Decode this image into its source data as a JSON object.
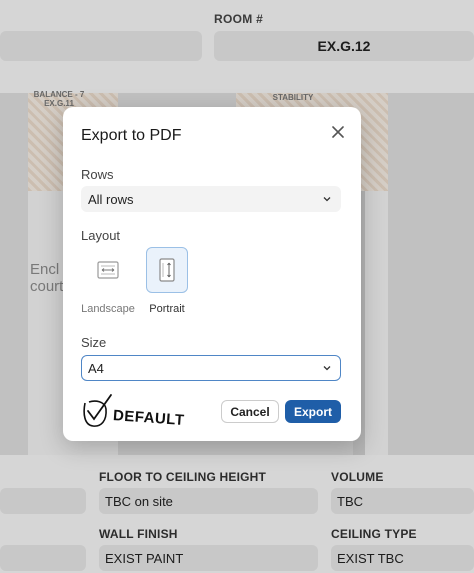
{
  "background": {
    "room_label": "ROOM #",
    "room_value": "EX.G.12",
    "plan_tag_left_1": "BALANCE - 7",
    "plan_tag_left_2": "EX.G.11",
    "plan_tag_right": "STABILITY",
    "plan_text_1": "Encl",
    "plan_text_2": "court",
    "floor_to_ceiling_label": "FLOOR TO CEILING HEIGHT",
    "floor_to_ceiling_value": "TBC on site",
    "volume_label": "VOLUME",
    "volume_value": "TBC",
    "wall_finish_label": "WALL FINISH",
    "wall_finish_value": "EXIST PAINT",
    "ceiling_type_label": "CEILING TYPE",
    "ceiling_type_value": "EXIST TBC"
  },
  "dialog": {
    "title": "Export to PDF",
    "close_icon": "close-icon",
    "rows_label": "Rows",
    "rows_value": "All rows",
    "layout_label": "Layout",
    "layout_options": [
      {
        "label": "Landscape",
        "icon": "landscape-page-icon",
        "selected": false
      },
      {
        "label": "Portrait",
        "icon": "portrait-page-icon",
        "selected": true
      }
    ],
    "size_label": "Size",
    "size_value": "A4",
    "cancel_label": "Cancel",
    "export_label": "Export",
    "signature_text": "DEFAULT",
    "accent_color": "#1f5ea8"
  }
}
